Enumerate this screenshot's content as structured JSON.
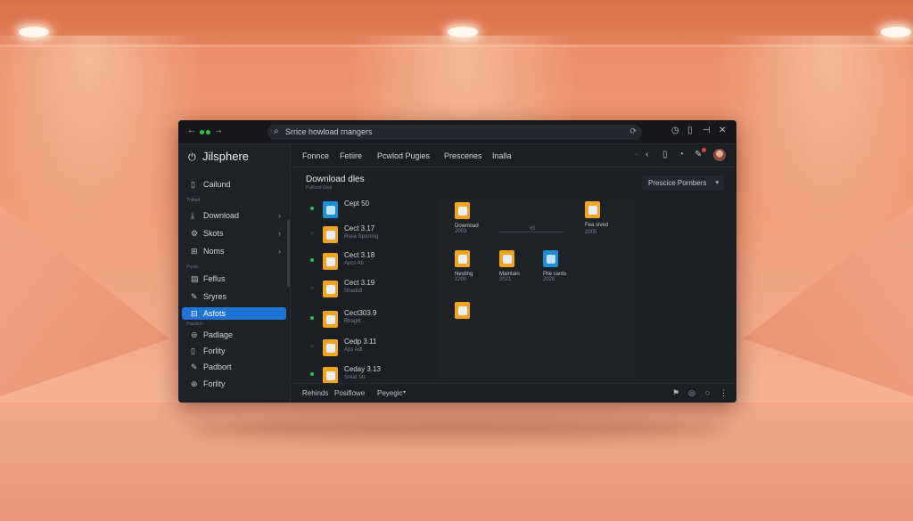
{
  "window": {
    "search_placeholder": "Srrice howload rnangers"
  },
  "sidebar": {
    "brand": "Jilsphere",
    "top_item": "Cailund",
    "section1": "Thitted",
    "items1": [
      "Download",
      "Skots",
      "Noms"
    ],
    "section2": "Posts",
    "items2": [
      "Feflus",
      "Sryres",
      "Asfots"
    ],
    "section3": "Pilastion",
    "items3": [
      "Padlage",
      "Forlity",
      "Padbort",
      "Forlity"
    ]
  },
  "tabs": [
    "Fonnce",
    "Fetiire",
    "Pcwlod Pugies",
    "Presceries",
    "Inalla"
  ],
  "main": {
    "title": "Download dles",
    "subtitle": "Pulliced Gialt",
    "preset_button": "Prescice Pornbers"
  },
  "list": [
    {
      "name": "Cept 50",
      "sub": "",
      "on": true,
      "icon": "blue"
    },
    {
      "name": "Cect 3.17",
      "sub": "Rose Sporring",
      "on": false,
      "icon": "orange"
    },
    {
      "name": "Cect 3.18",
      "sub": "Apcs Ati",
      "on": true,
      "icon": "orange"
    },
    {
      "name": "Cect 3.19",
      "sub": "Shadidl",
      "on": false,
      "icon": "orange"
    },
    {
      "name": "Cect303.9",
      "sub": "Bhagtit",
      "on": true,
      "icon": "orange"
    },
    {
      "name": "Cedp 3.11",
      "sub": "Aps Adl",
      "on": false,
      "icon": "orange"
    },
    {
      "name": "Ceday 3.13",
      "sub": "Sreat Str",
      "on": true,
      "icon": "orange"
    }
  ],
  "grid": [
    {
      "l1": "Download",
      "l2": "2003"
    },
    {
      "l1": "Nesting",
      "l2": "2200"
    },
    {
      "l1": "Maintain",
      "l2": "2021"
    },
    {
      "l1": "Pile cards",
      "l2": "2020"
    },
    {
      "l1": "Fea sived",
      "l2": "2005"
    }
  ],
  "grid_mid_label": "x5",
  "bottom": [
    "Rehinds",
    "Posiflowe",
    "Peyegic"
  ],
  "colors": {
    "accent": "#1f74d6",
    "online": "#27c24a",
    "folder": "#f2a41f"
  }
}
